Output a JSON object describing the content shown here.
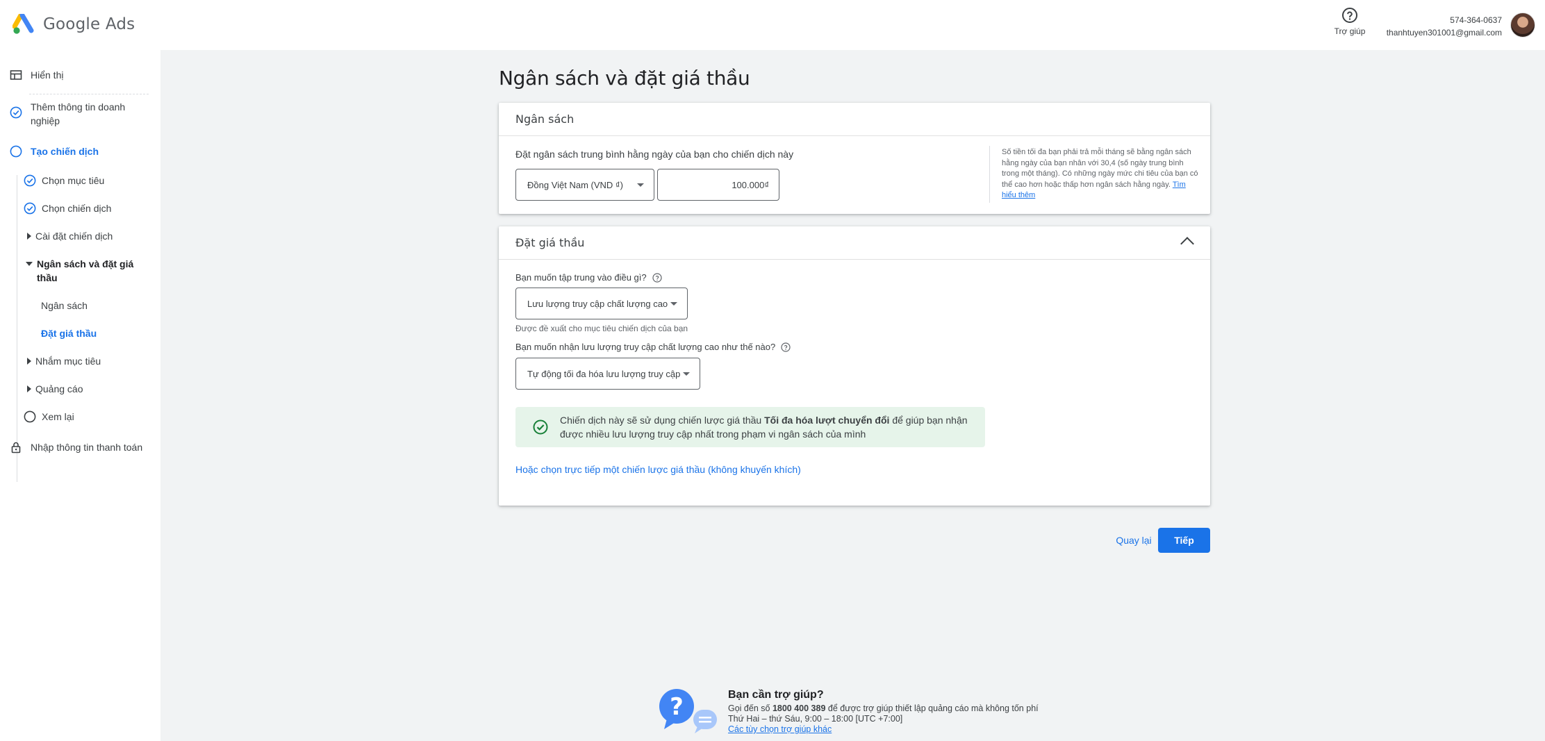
{
  "header": {
    "app_name": "Google Ads",
    "help_label": "Trợ giúp",
    "phone": "574-364-0637",
    "email": "thanhtuyen301001@gmail.com"
  },
  "sidebar": {
    "items": [
      {
        "label": "Hiển thị"
      },
      {
        "label": "Thêm thông tin doanh nghiệp"
      },
      {
        "label": "Tạo chiến dịch"
      },
      {
        "label": "Chọn mục tiêu"
      },
      {
        "label": "Chọn chiến dịch"
      },
      {
        "label": "Cài đặt chiến dịch"
      },
      {
        "label": "Ngân sách và đặt giá thầu"
      },
      {
        "label": "Ngân sách"
      },
      {
        "label": "Đặt giá thầu"
      },
      {
        "label": "Nhắm mục tiêu"
      },
      {
        "label": "Quảng cáo"
      },
      {
        "label": "Xem lại"
      },
      {
        "label": "Nhập thông tin thanh toán"
      }
    ]
  },
  "main": {
    "title": "Ngân sách và đặt giá thầu",
    "budget": {
      "heading": "Ngân sách",
      "label": "Đặt ngân sách trung bình hằng ngày của bạn cho chiến dịch này",
      "currency": "Đồng Việt Nam (VND ₫)",
      "amount": "100.000₫",
      "note": "Số tiền tối đa bạn phải trả mỗi tháng sẽ bằng ngân sách hằng ngày của bạn nhân với 30,4 (số ngày trung bình trong một tháng). Có những ngày mức chi tiêu của bạn có thể cao hơn hoặc thấp hơn ngân sách hằng ngày.",
      "learn_more": "Tìm hiểu thêm"
    },
    "bidding": {
      "heading": "Đặt giá thầu",
      "focus_question": "Bạn muốn tập trung vào điều gì?",
      "focus_value": "Lưu lượng truy cập chất lượng cao",
      "focus_hint": "Được đề xuất cho mục tiêu chiến dịch của bạn",
      "how_question": "Bạn muốn nhận lưu lượng truy cập chất lượng cao như thế nào?",
      "how_value": "Tự động tối đa hóa lưu lượng truy cập",
      "info_pre": "Chiến dịch này sẽ sử dụng chiến lược giá thầu ",
      "info_bold": "Tối đa hóa lượt chuyển đổi",
      "info_post": " để giúp bạn nhận được nhiều lưu lượng truy cập nhất trong phạm vi ngân sách của mình",
      "manual_link": "Hoặc chọn trực tiếp một chiến lược giá thầu (không khuyến khích)"
    },
    "back_label": "Quay lại",
    "next_label": "Tiếp"
  },
  "support": {
    "title": "Bạn cần trợ giúp?",
    "line1_pre": "Gọi đến số ",
    "phone": "1800 400 389",
    "line1_post": " để được trợ giúp thiết lập quảng cáo mà không tốn phí",
    "hours": "Thứ Hai – thứ Sáu, 9:00 – 18:00 [UTC +7:00]",
    "other_link": "Các tùy chọn trợ giúp khác"
  },
  "colors": {
    "accent": "#1a73e8",
    "success_bg": "#e6f4ea",
    "success_icon": "#188038"
  }
}
